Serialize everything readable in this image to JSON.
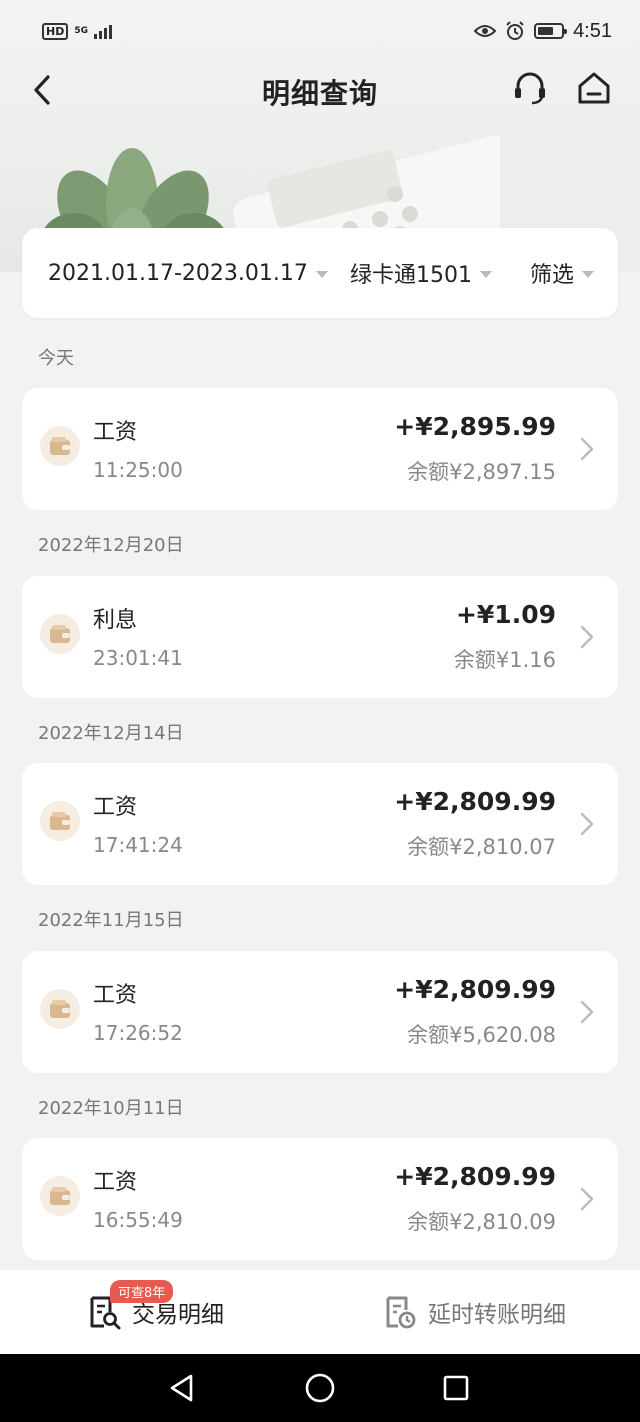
{
  "status_bar": {
    "network_badge": "HD",
    "network_type": "5G",
    "time": "4:51"
  },
  "header": {
    "title": "明细查询",
    "back_icon": "chevron-left-icon",
    "service_icon": "headset-icon",
    "home_icon": "home-icon"
  },
  "filters": {
    "date_range": "2021.01.17-2023.01.17",
    "account": "绿卡通1501",
    "filter_label": "筛选"
  },
  "groups": [
    {
      "date": "今天",
      "tx": {
        "title": "工资",
        "time": "11:25:00",
        "amount": "+¥2,895.99",
        "balance": "余额¥2,897.15"
      }
    },
    {
      "date": "2022年12月20日",
      "tx": {
        "title": "利息",
        "time": "23:01:41",
        "amount": "+¥1.09",
        "balance": "余额¥1.16"
      }
    },
    {
      "date": "2022年12月14日",
      "tx": {
        "title": "工资",
        "time": "17:41:24",
        "amount": "+¥2,809.99",
        "balance": "余额¥2,810.07"
      }
    },
    {
      "date": "2022年11月15日",
      "tx": {
        "title": "工资",
        "time": "17:26:52",
        "amount": "+¥2,809.99",
        "balance": "余额¥5,620.08"
      }
    },
    {
      "date": "2022年10月11日",
      "tx": {
        "title": "工资",
        "time": "16:55:49",
        "amount": "+¥2,809.99",
        "balance": "余额¥2,810.09"
      }
    }
  ],
  "bottom_tabs": {
    "badge": "可查8年",
    "active_label": "交易明细",
    "inactive_label": "延时转账明细"
  },
  "colors": {
    "accent_badge": "#e85a4f",
    "icon_bg": "#f6ede2",
    "icon_fg": "#d9b88f"
  }
}
